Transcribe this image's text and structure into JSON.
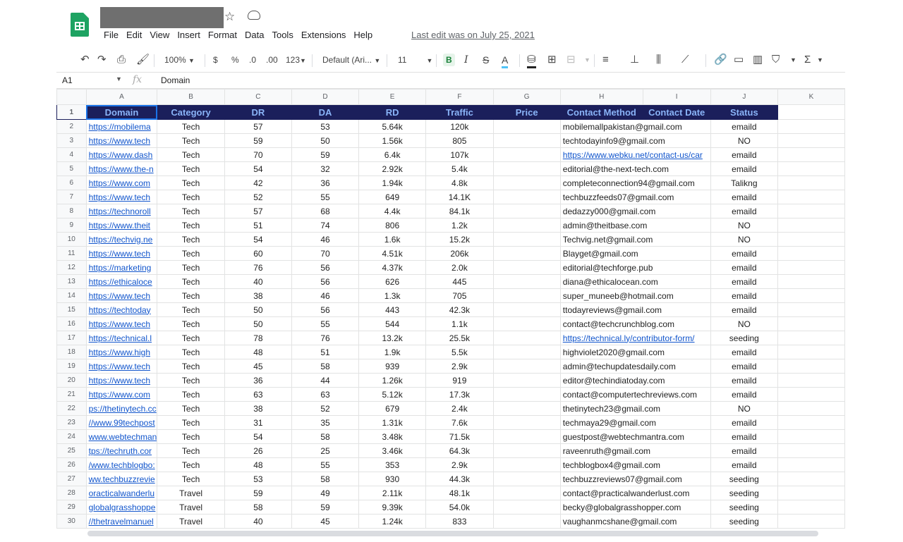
{
  "app": {
    "menu": [
      "File",
      "Edit",
      "View",
      "Insert",
      "Format",
      "Data",
      "Tools",
      "Extensions",
      "Help"
    ],
    "last_edit": "Last edit was on July 25, 2021"
  },
  "toolbar": {
    "zoom": "100%",
    "currency": "$",
    "percent": "%",
    "dec_less": ".0",
    "dec_more": ".00",
    "number_format": "123",
    "font": "Default (Ari...",
    "font_size": "11",
    "bold": "B",
    "italic": "I",
    "strike": "S",
    "text_color": "A",
    "sum": "Σ"
  },
  "formula_bar": {
    "cell": "A1",
    "fx": "fx",
    "value": "Domain"
  },
  "columns": [
    "A",
    "B",
    "C",
    "D",
    "E",
    "F",
    "G",
    "H",
    "I",
    "J",
    "K"
  ],
  "header_row": [
    "Domain",
    "Category",
    "DR",
    "DA",
    "RD",
    "Traffic",
    "Price",
    "Contact Method",
    "Contact Date",
    "Status"
  ],
  "rows": [
    {
      "n": "2",
      "domain": "https://mobilema",
      "cat": "Tech",
      "dr": "57",
      "da": "53",
      "rd": "5.64k",
      "traffic": "120k",
      "contact": "mobilemallpakistan@gmail.com",
      "status": "emaild"
    },
    {
      "n": "3",
      "domain": "https://www.tech",
      "cat": "Tech",
      "dr": "59",
      "da": "50",
      "rd": "1.56k",
      "traffic": "805",
      "contact": "techtodayinfo9@gmail.com",
      "status": "NO"
    },
    {
      "n": "4",
      "domain": "https://www.dash",
      "cat": "Tech",
      "dr": "70",
      "da": "59",
      "rd": "6.4k",
      "traffic": "107k",
      "contact": "https://www.webku.net/contact-us/car",
      "status": "emaild",
      "contact_link": true
    },
    {
      "n": "5",
      "domain": "https://www.the-n",
      "cat": "Tech",
      "dr": "54",
      "da": "32",
      "rd": "2.92k",
      "traffic": "5.4k",
      "contact": "editorial@the-next-tech.com",
      "status": "emaild"
    },
    {
      "n": "6",
      "domain": "https://www.com",
      "cat": "Tech",
      "dr": "42",
      "da": "36",
      "rd": "1.94k",
      "traffic": "4.8k",
      "contact": "completeconnection94@gmail.com",
      "status": "Talikng"
    },
    {
      "n": "7",
      "domain": "https://www.tech",
      "cat": "Tech",
      "dr": "52",
      "da": "55",
      "rd": "649",
      "traffic": "14.1K",
      "contact": "techbuzzfeeds07@gmail.com",
      "status": "emaild"
    },
    {
      "n": "8",
      "domain": "https://technoroll",
      "cat": "Tech",
      "dr": "57",
      "da": "68",
      "rd": "4.4k",
      "traffic": "84.1k",
      "contact": "dedazzy000@gmail.com",
      "status": "emaild"
    },
    {
      "n": "9",
      "domain": "https://www.theit",
      "cat": "Tech",
      "dr": "51",
      "da": "74",
      "rd": "806",
      "traffic": "1.2k",
      "contact": "admin@theitbase.com",
      "status": "NO"
    },
    {
      "n": "10",
      "domain": "https://techvig.ne",
      "cat": "Tech",
      "dr": "54",
      "da": "46",
      "rd": "1.6k",
      "traffic": "15.2k",
      "contact": "Techvig.net@gmail.com",
      "status": "NO"
    },
    {
      "n": "11",
      "domain": "https://www.tech",
      "cat": "Tech",
      "dr": "60",
      "da": "70",
      "rd": "4.51k",
      "traffic": "206k",
      "contact": "Blayget@gmail.com",
      "status": "emaild"
    },
    {
      "n": "12",
      "domain": "https://marketing",
      "cat": "Tech",
      "dr": "76",
      "da": "56",
      "rd": "4.37k",
      "traffic": "2.0k",
      "contact": "editorial@techforge.pub",
      "status": "emaild"
    },
    {
      "n": "13",
      "domain": "https://ethicaloce",
      "cat": "Tech",
      "dr": "40",
      "da": "56",
      "rd": "626",
      "traffic": "445",
      "contact": "diana@ethicalocean.com",
      "status": "emaild"
    },
    {
      "n": "14",
      "domain": "https://www.tech",
      "cat": "Tech",
      "dr": "38",
      "da": "46",
      "rd": "1.3k",
      "traffic": "705",
      "contact": "super_muneeb@hotmail.com",
      "status": "emaild"
    },
    {
      "n": "15",
      "domain": "https://techtoday",
      "cat": "Tech",
      "dr": "50",
      "da": "56",
      "rd": "443",
      "traffic": "42.3k",
      "contact": "ttodayreviews@gmail.com",
      "status": "emaild"
    },
    {
      "n": "16",
      "domain": "https://www.tech",
      "cat": "Tech",
      "dr": "50",
      "da": "55",
      "rd": "544",
      "traffic": "1.1k",
      "contact": "contact@techcrunchblog.com",
      "status": "NO"
    },
    {
      "n": "17",
      "domain": "https://technical.l",
      "cat": "Tech",
      "dr": "78",
      "da": "76",
      "rd": "13.2k",
      "traffic": "25.5k",
      "contact": "https://technical.ly/contributor-form/",
      "status": "seeding",
      "contact_link": true
    },
    {
      "n": "18",
      "domain": "https://www.high",
      "cat": "Tech",
      "dr": "48",
      "da": "51",
      "rd": "1.9k",
      "traffic": "5.5k",
      "contact": "highviolet2020@gmail.com",
      "status": "emaild"
    },
    {
      "n": "19",
      "domain": "https://www.tech",
      "cat": "Tech",
      "dr": "45",
      "da": "58",
      "rd": "939",
      "traffic": "2.9k",
      "contact": "admin@techupdatesdaily.com",
      "status": "emaild"
    },
    {
      "n": "20",
      "domain": "https://www.tech",
      "cat": "Tech",
      "dr": "36",
      "da": "44",
      "rd": "1.26k",
      "traffic": "919",
      "contact": "editor@techindiatoday.com",
      "status": "emaild"
    },
    {
      "n": "21",
      "domain": "https://www.com",
      "cat": "Tech",
      "dr": "63",
      "da": "63",
      "rd": "5.12k",
      "traffic": "17.3k",
      "contact": "contact@computertechreviews.com",
      "status": "emaild"
    },
    {
      "n": "22",
      "domain": "ps://thetinytech.cc",
      "cat": "Tech",
      "dr": "38",
      "da": "52",
      "rd": "679",
      "traffic": "2.4k",
      "contact": "thetinytech23@gmail.com",
      "status": "NO"
    },
    {
      "n": "23",
      "domain": "//www.99techpost",
      "cat": "Tech",
      "dr": "31",
      "da": "35",
      "rd": "1.31k",
      "traffic": "7.6k",
      "contact": "techmaya29@gmail.com",
      "status": "emaild"
    },
    {
      "n": "24",
      "domain": "www.webtechman",
      "cat": "Tech",
      "dr": "54",
      "da": "58",
      "rd": "3.48k",
      "traffic": "71.5k",
      "contact": "guestpost@webtechmantra.com",
      "status": "emaild"
    },
    {
      "n": "25",
      "domain": "tps://techruth.cor",
      "cat": "Tech",
      "dr": "26",
      "da": "25",
      "rd": "3.46k",
      "traffic": "64.3k",
      "contact": "raveenruth@gmail.com",
      "status": "emaild"
    },
    {
      "n": "26",
      "domain": "/www.techblogbo:",
      "cat": "Tech",
      "dr": "48",
      "da": "55",
      "rd": "353",
      "traffic": "2.9k",
      "contact": "techblogbox4@gmail.com",
      "status": "emaild"
    },
    {
      "n": "27",
      "domain": "ww.techbuzzrevie",
      "cat": "Tech",
      "dr": "53",
      "da": "58",
      "rd": "930",
      "traffic": "44.3k",
      "contact": "techbuzzreviews07@gmail.com",
      "status": "seeding"
    },
    {
      "n": "28",
      "domain": "oracticalwanderlu",
      "cat": "Travel",
      "dr": "59",
      "da": "49",
      "rd": "2.11k",
      "traffic": "48.1k",
      "contact": "contact@practicalwanderlust.com",
      "status": "seeding"
    },
    {
      "n": "29",
      "domain": "globalgrasshoppe",
      "cat": "Travel",
      "dr": "58",
      "da": "59",
      "rd": "9.39k",
      "traffic": "54.0k",
      "contact": "becky@globalgrasshopper.com",
      "status": "seeding"
    },
    {
      "n": "30",
      "domain": "//thetravelmanuel",
      "cat": "Travel",
      "dr": "40",
      "da": "45",
      "rd": "1.24k",
      "traffic": "833",
      "contact": "vaughanmcshane@gmail.com",
      "status": "seeding"
    }
  ]
}
